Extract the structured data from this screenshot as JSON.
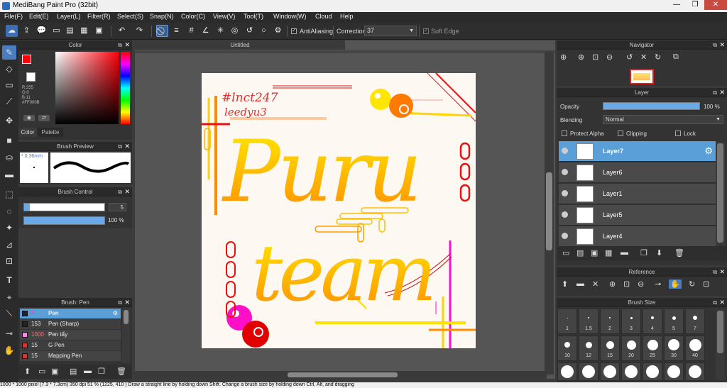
{
  "app": {
    "title": "MediBang Paint Pro (32bit)"
  },
  "menu": [
    "File(F)",
    "Edit(E)",
    "Layer(L)",
    "Filter(R)",
    "Select(S)",
    "Snap(N)",
    "Color(C)",
    "View(V)",
    "Tool(T)",
    "Window(W)",
    "Cloud",
    "Help"
  ],
  "toolbar": {
    "antialias_label": "AntiAliasing",
    "correction_label": "Correction",
    "correction_value": "37",
    "soft_edge_label": "Soft Edge"
  },
  "color_panel": {
    "title": "Color",
    "r": "R:255",
    "g": "G:0",
    "b": "B:11",
    "hex": "#FF000B",
    "tab_color": "Color",
    "tab_palette": "Palette",
    "fg": "#ff000b"
  },
  "brush_preview": {
    "title": "Brush Preview",
    "size": "0.36mm"
  },
  "brush_control": {
    "title": "Brush Control",
    "size_value": "5",
    "opacity_value": "100 %"
  },
  "brush_list": {
    "title": "Brush: Pen",
    "items": [
      {
        "size": "5",
        "name": "Pen",
        "color": "#222222",
        "selected": true
      },
      {
        "size": "153",
        "name": "Pen (Sharp)",
        "color": "#222222"
      },
      {
        "size": "1000",
        "name": "Pen tẩy",
        "color": "#ff88ee"
      },
      {
        "size": "15",
        "name": "G Pen",
        "color": "#e03030"
      },
      {
        "size": "15",
        "name": "Mapping Pen",
        "color": "#e03030"
      }
    ]
  },
  "canvas": {
    "tab": "Untitled"
  },
  "artwork": {
    "tag1": "#lnct247",
    "tag2": "leedyu3",
    "word1": "Puru",
    "word2": "team"
  },
  "navigator": {
    "title": "Navigator"
  },
  "layer_panel": {
    "title": "Layer",
    "opacity_label": "Opacity",
    "opacity_value": "100 %",
    "blending_label": "Blending",
    "blending_value": "Normal",
    "protect_alpha": "Protect Alpha",
    "clipping": "Clipping",
    "lock": "Lock",
    "layers": [
      "Layer7",
      "Layer6",
      "Layer1",
      "Layer5",
      "Layer4"
    ]
  },
  "reference": {
    "title": "Reference"
  },
  "brush_size": {
    "title": "Brush Size",
    "row1": [
      "1",
      "1.5",
      "2",
      "3",
      "4",
      "5",
      "7"
    ],
    "row2": [
      "10",
      "12",
      "15",
      "20",
      "25",
      "30",
      "40"
    ]
  },
  "status": {
    "text": "1000 * 1000 pixel   (7.3 * 7.3cm)   350 dpi   51 %   (1225, 410 )   Draw a straight line by holding down Shift. Change a brush size by holding down Ctrl, Alt, and dragging"
  }
}
